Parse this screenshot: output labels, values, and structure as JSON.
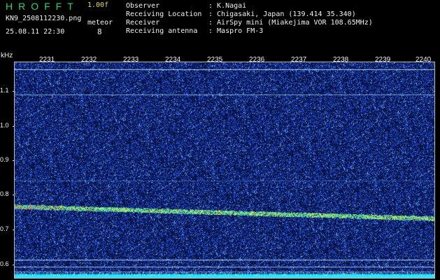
{
  "header": {
    "logo": "HROFFT",
    "version": "1.00f",
    "filename": "KN9_2508112230.png",
    "meteor_label": "meteor",
    "meteor_count": "8",
    "datetime": "25.08.11 22:30",
    "meta": [
      {
        "label": "Observer",
        "value": ": K.Nagai"
      },
      {
        "label": "Receiving Location",
        "value": ": Chigasaki, Japan (139.414 35.340)"
      },
      {
        "label": "Receiver",
        "value": ": AirSpy mini (Miakejima VOR 108.65MHz)"
      },
      {
        "label": "Receiving antenna",
        "value": ": Maspro FM-3"
      }
    ]
  },
  "axes": {
    "y_unit": "kHz",
    "y_ticks": [
      "1.1",
      "1.0",
      "0.9",
      "0.8",
      "0.7",
      "0.6"
    ],
    "x_ticks": [
      "2231",
      "2232",
      "2233",
      "2234",
      "2235",
      "2236",
      "2237",
      "2238",
      "2239",
      "2240"
    ]
  },
  "colors": {
    "background": "#000000",
    "plot_bg": "#06113f",
    "noise": "#2d5cff",
    "trail": "#d3e83a",
    "logo": "#2bd36a",
    "version": "#e8d95a"
  }
}
